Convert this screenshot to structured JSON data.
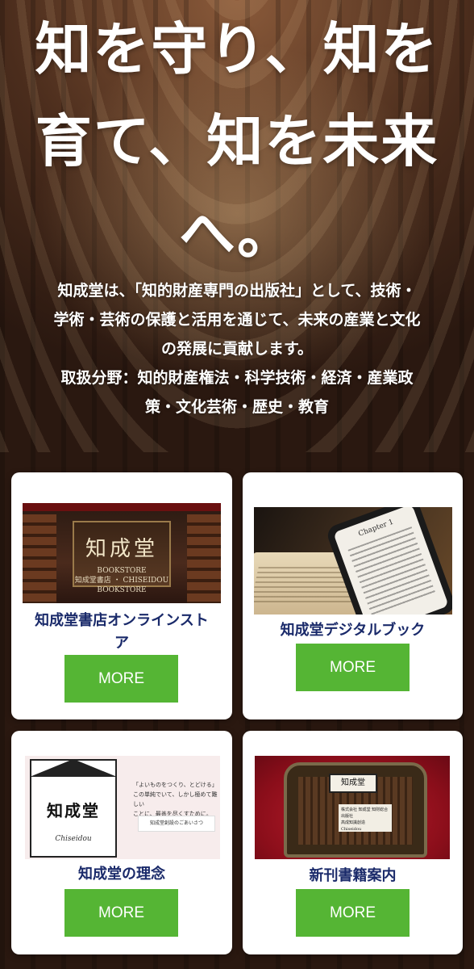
{
  "hero": {
    "title_lines": [
      "知を守り、知を",
      "育て、知を未来",
      "へ。"
    ],
    "intro_lines": [
      "知成堂は、「知的財産専門の出版社」として、技術・",
      "学術・芸術の保護と活用を通じて、未来の産業と文化",
      "の発展に貢献します。",
      "取扱分野：知的財産権法・科学技術・経済・産業政",
      "策・文化芸術・歴史・教育"
    ]
  },
  "cards": [
    {
      "title_lines": [
        "知成堂書店オンラインスト",
        "ア"
      ],
      "button": "MORE",
      "thumb": {
        "big": "知成堂",
        "small_lines": [
          "BOOKSTORE",
          "知成堂書店 ・ CHISEIDOU",
          "BOOKSTORE"
        ]
      }
    },
    {
      "title_lines": [
        "知成堂デジタルブック"
      ],
      "button": "MORE",
      "thumb": {
        "screen_text": "Chapter 1"
      }
    },
    {
      "title_lines": [
        "知成堂の理念"
      ],
      "button": "MORE",
      "thumb": {
        "logo": "知成堂",
        "tag": "Chiseidou",
        "text_lines": [
          "「よいものをつくり、とどける」",
          "この単純でいて、しかし極めて難しい",
          "ことに、最善を尽くすために。"
        ],
        "box": "知成堂創設のごあいさつ"
      }
    },
    {
      "title_lines": [
        "新刊書籍案内"
      ],
      "button": "MORE",
      "thumb": {
        "plate": "知成堂",
        "card_lines": [
          "株式会社 知成堂 知財総合出版社",
          "高成知識創造",
          "Chiseidou"
        ]
      }
    }
  ],
  "colors": {
    "button": "#55b534",
    "card_title": "#1a2a6a",
    "hero_text": "#ffffff"
  }
}
